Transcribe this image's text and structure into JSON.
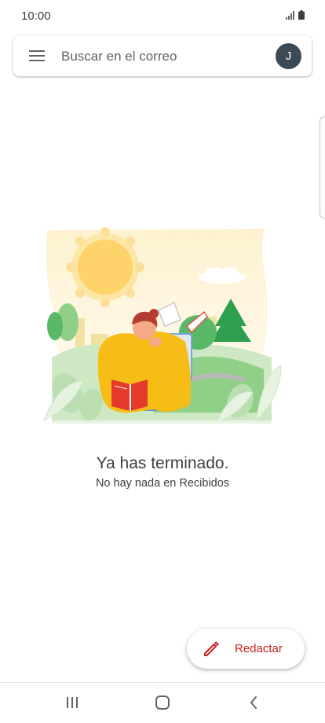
{
  "status_bar": {
    "time": "10:00"
  },
  "search_bar": {
    "menu_icon": "hamburger-menu-icon",
    "placeholder": "Buscar en el correo",
    "avatar_initial": "J"
  },
  "empty_state": {
    "illustration": "reading-woman-illustration",
    "title": "Ya has terminado.",
    "subtitle": "No hay nada en Recibidos"
  },
  "compose": {
    "icon": "pencil-icon",
    "label": "Redactar"
  },
  "navigation": {
    "recent_icon": "recent-apps-icon",
    "home_icon": "home-icon",
    "back_icon": "back-icon"
  },
  "colors": {
    "compose_accent": "#c5221f",
    "avatar_bg": "#3c4a56",
    "sun": "#fdd36a",
    "tree_green": "#2e9e4f"
  }
}
